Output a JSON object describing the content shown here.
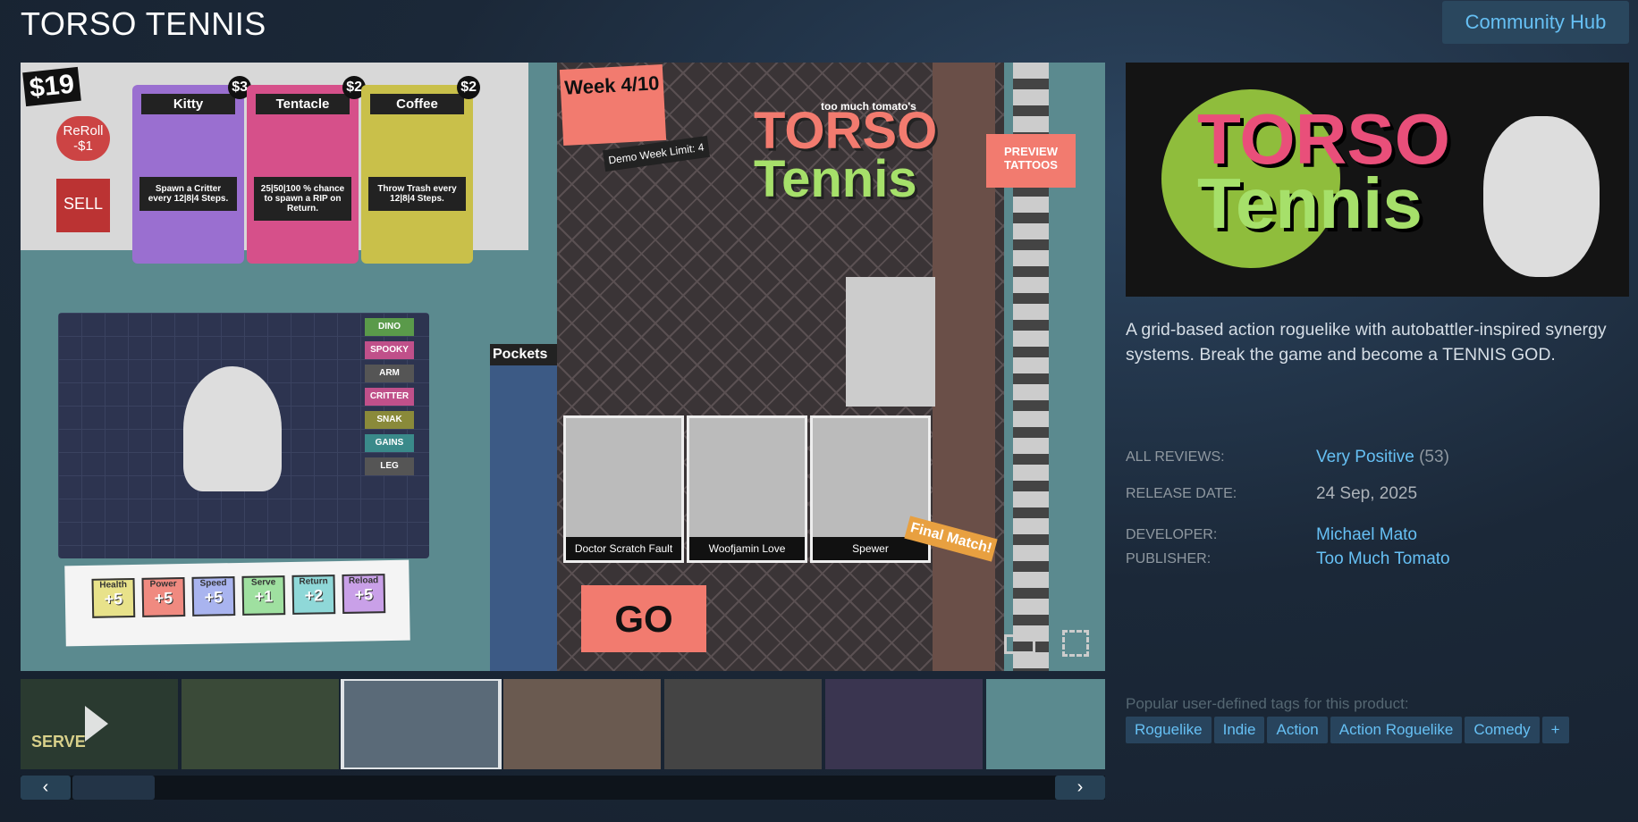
{
  "title": "TORSO TENNIS",
  "community_hub": "Community Hub",
  "screenshot": {
    "money": "$19",
    "reroll": "ReRoll -$1",
    "sell": "SELL",
    "cards": [
      {
        "name": "Kitty",
        "price": "$3",
        "desc": "Spawn a Critter every 12|8|4 Steps.",
        "color": "#9a6fd0"
      },
      {
        "name": "Tentacle",
        "price": "$2",
        "desc": "25|50|100 % chance to spawn a RIP on Return.",
        "color": "#d6508a"
      },
      {
        "name": "Coffee",
        "price": "$2",
        "desc": "Throw Trash every 12|8|4 Steps.",
        "color": "#c9c04a"
      }
    ],
    "week": "Week 4/10",
    "demo": "Demo Week Limit: 4",
    "logo_small": "too much tomato's",
    "logo": [
      "TORSO",
      "Tennis"
    ],
    "preview": "PREVIEW TATTOOS",
    "pockets": "Pockets",
    "tags": [
      "DINO",
      "SPOOKY",
      "ARM",
      "CRITTER",
      "SNAK",
      "GAINS",
      "LEG"
    ],
    "opponents": [
      "Doctor Scratch Fault",
      "Woofjamin Love",
      "Spewer"
    ],
    "final": "Final Match!",
    "go": "GO",
    "stats": [
      {
        "l": "Health",
        "v": "+5",
        "c": "#e8e28a"
      },
      {
        "l": "Power",
        "v": "+5",
        "c": "#f08a80"
      },
      {
        "l": "Speed",
        "v": "+5",
        "c": "#a9b4ef"
      },
      {
        "l": "Serve",
        "v": "+1",
        "c": "#9fe0a0"
      },
      {
        "l": "Return",
        "v": "+2",
        "c": "#8fd8d8"
      },
      {
        "l": "Reload",
        "v": "+5",
        "c": "#c9a0e8"
      }
    ]
  },
  "thumbnails": [
    {
      "color": "#2a3a30",
      "video": true,
      "label": "SERVE"
    },
    {
      "color": "#3a4a38"
    },
    {
      "color": "#5a6a78",
      "selected": true
    },
    {
      "color": "#6a5a50"
    },
    {
      "color": "#444"
    },
    {
      "color": "#3a3550"
    },
    {
      "color": "#5b8a8f"
    }
  ],
  "capsule_logo": [
    "TORSO",
    "Tennis"
  ],
  "description": "A grid-based action roguelike with autobattler-inspired synergy systems. Break the game and become a TENNIS GOD.",
  "info": {
    "reviews_label": "ALL REVIEWS:",
    "reviews_value": "Very Positive",
    "reviews_count": "(53)",
    "release_label": "RELEASE DATE:",
    "release_value": "24 Sep, 2025",
    "developer_label": "DEVELOPER:",
    "developer_value": "Michael Mato",
    "publisher_label": "PUBLISHER:",
    "publisher_value": "Too Much Tomato"
  },
  "tags_label": "Popular user-defined tags for this product:",
  "tags": [
    "Roguelike",
    "Indie",
    "Action",
    "Action Roguelike",
    "Comedy",
    "+"
  ],
  "nav": {
    "prev": "‹",
    "next": "›"
  }
}
